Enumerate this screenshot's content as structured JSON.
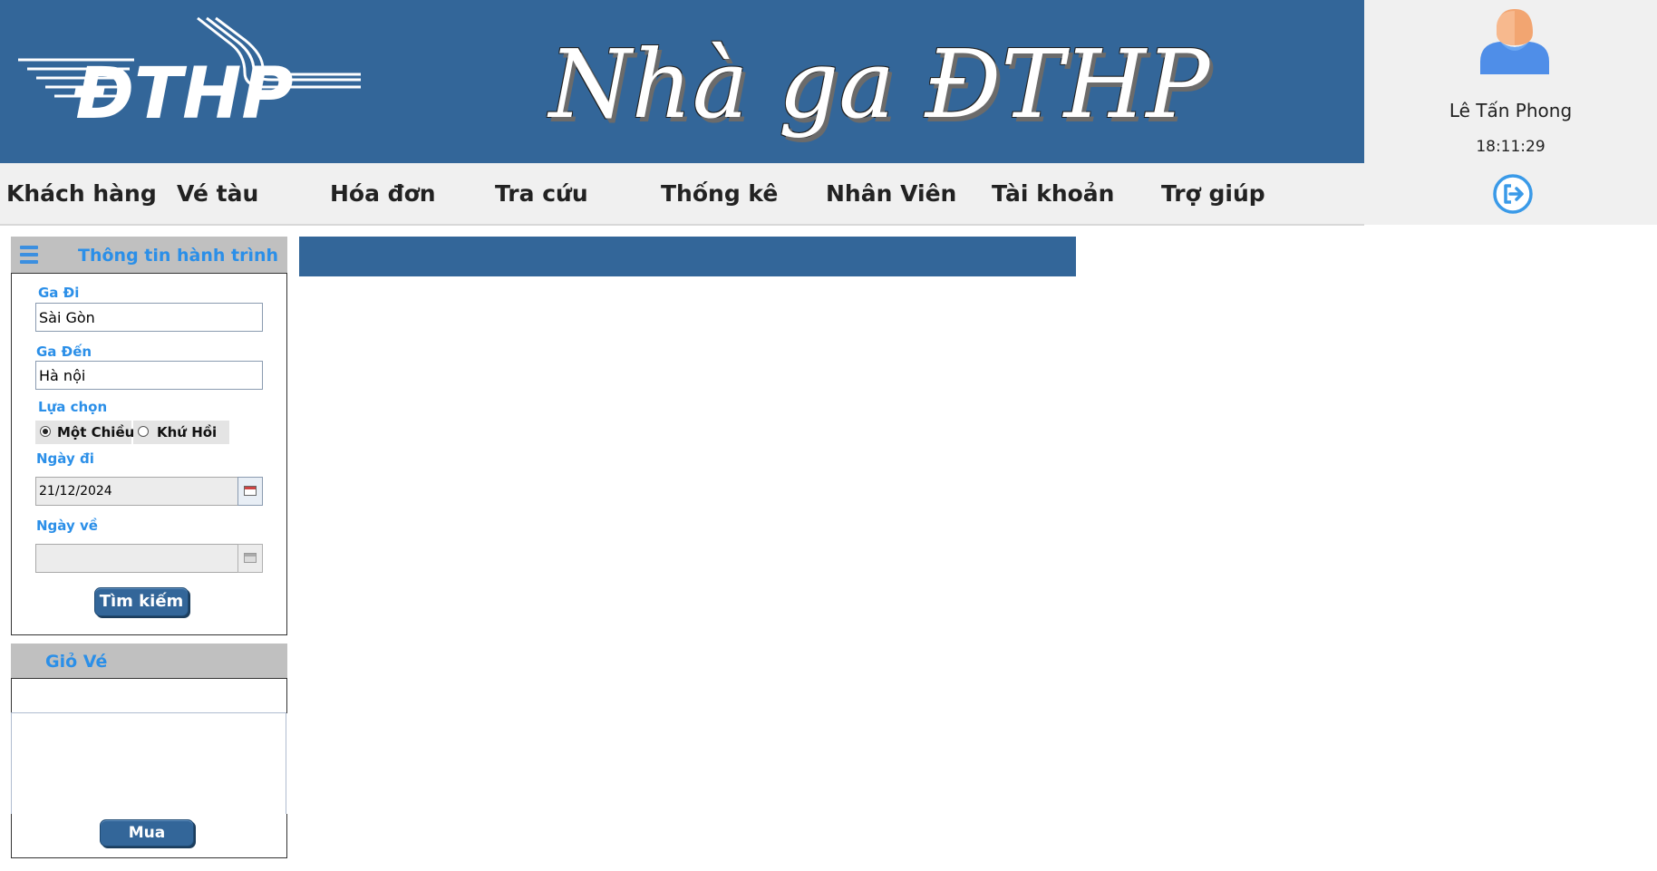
{
  "header": {
    "logo_text": "ĐTHP",
    "brand_title": "Nhà ga ĐTHP"
  },
  "user": {
    "name": "Lê Tấn Phong",
    "clock": "18:11:29",
    "avatar_icon": "user-avatar-icon",
    "logout_icon": "logout-icon"
  },
  "menu": {
    "items": [
      {
        "label": "Khách hàng"
      },
      {
        "label": "Vé tàu"
      },
      {
        "label": "Hóa đơn"
      },
      {
        "label": "Tra cứu"
      },
      {
        "label": "Thống kê"
      },
      {
        "label": "Nhân Viên"
      },
      {
        "label": "Tài khoản"
      },
      {
        "label": "Trợ giúp"
      }
    ]
  },
  "journey": {
    "title": "Thông tin hành trình",
    "from_label": "Ga Đi",
    "from_value": "Sài Gòn",
    "to_label": "Ga Đến",
    "to_value": "Hà nội",
    "option_label": "Lựa chọn",
    "one_way_label": "Một Chiều",
    "round_trip_label": "Khứ Hồi",
    "selected_option": "one_way",
    "depart_label": "Ngày đi",
    "depart_value": "21/12/2024",
    "return_label": "Ngày về",
    "return_value": "",
    "search_label": "Tìm kiếm"
  },
  "cart": {
    "title": "Giỏ Vé",
    "buy_label": "Mua"
  },
  "colors": {
    "primary": "#336699",
    "accent_text": "#2b8fe8",
    "panel_gray": "#c0c0c0",
    "menu_bg": "#f0f0f0"
  }
}
